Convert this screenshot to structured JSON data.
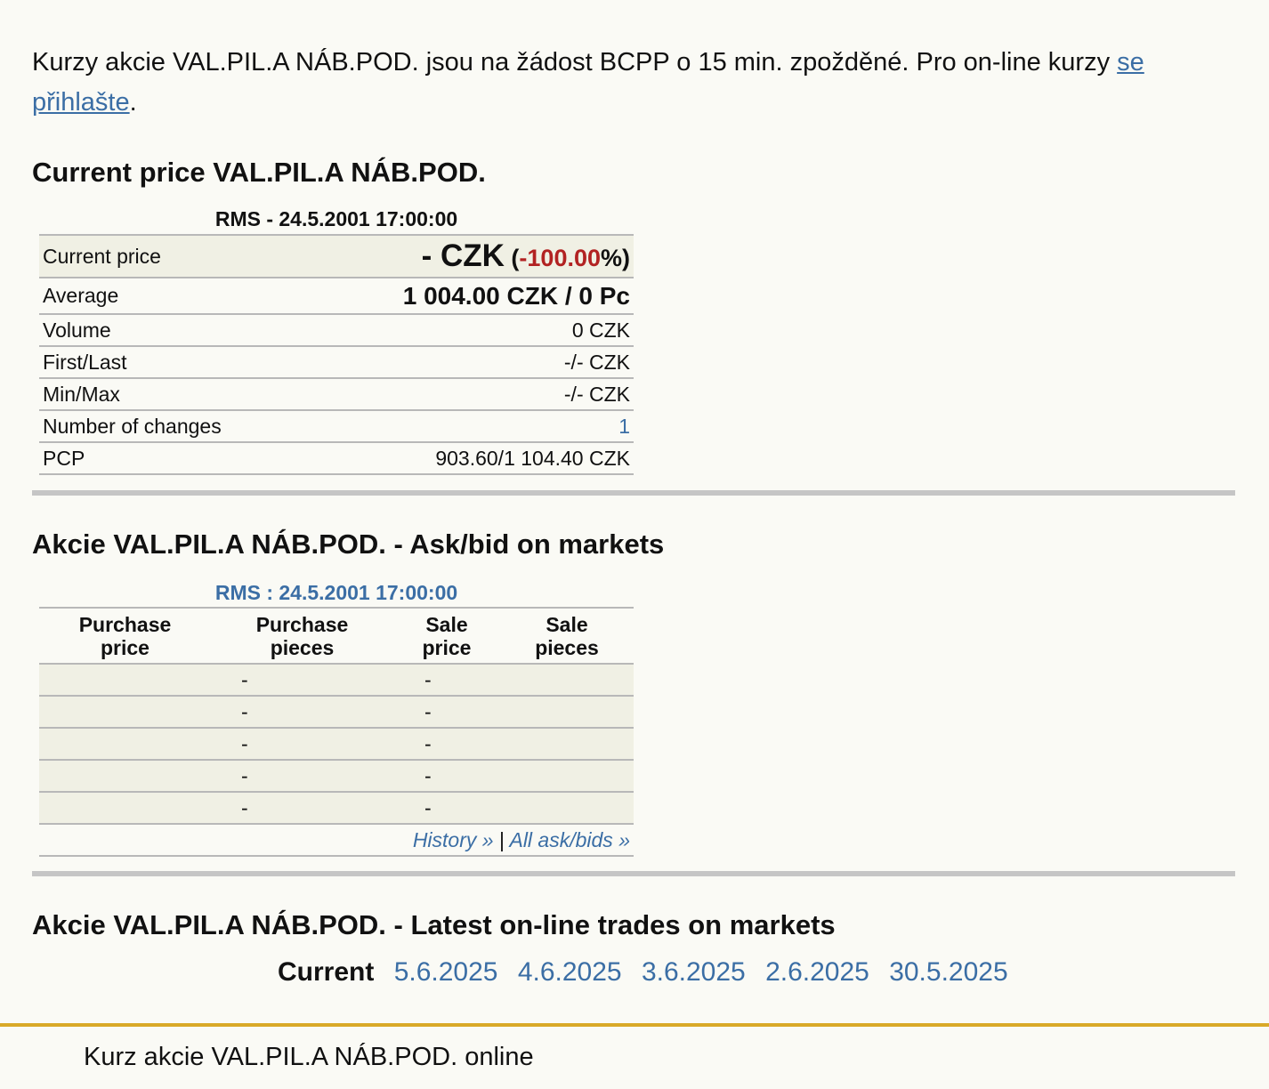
{
  "notice": {
    "text": "Kurzy akcie VAL.PIL.A NÁB.POD. jsou na žádost BCPP o 15 min. zpožděné. Pro on-line kurzy ",
    "link_text": "se přihlašte",
    "end": "."
  },
  "current": {
    "heading": "Current price VAL.PIL.A NÁB.POD.",
    "caption": "RMS - 24.5.2001 17:00:00",
    "price_label": "Current price",
    "price_value": "- CZK",
    "pct_open": " (",
    "pct_value": "-100.00",
    "pct_close": "%)",
    "average_label": "Average",
    "average_value": "1 004.00 CZK / 0 Pc",
    "rows": [
      {
        "label": "Volume",
        "value": "0 CZK"
      },
      {
        "label": "First/Last",
        "value": "-/- CZK"
      },
      {
        "label": "Min/Max",
        "value": "-/- CZK"
      },
      {
        "label": "Number of changes",
        "value": "1"
      },
      {
        "label": "PCP",
        "value": "903.60/1 104.40 CZK"
      }
    ]
  },
  "orderbook": {
    "heading": "Akcie VAL.PIL.A NÁB.POD. - Ask/bid on markets",
    "caption": "RMS : 24.5.2001 17:00:00",
    "columns": [
      "Purchase\nprice",
      "Purchase\npieces",
      "Sale\nprice",
      "Sale\npieces"
    ],
    "rows": [
      [
        "",
        "-",
        "-",
        ""
      ],
      [
        "",
        "-",
        "-",
        ""
      ],
      [
        "",
        "-",
        "-",
        ""
      ],
      [
        "",
        "-",
        "-",
        ""
      ],
      [
        "",
        "-",
        "-",
        ""
      ]
    ],
    "history_link": "History »",
    "separator": "|",
    "all_link": "All ask/bids »"
  },
  "trades": {
    "heading": "Akcie VAL.PIL.A NÁB.POD. - Latest on-line trades on markets",
    "current_label": "Current",
    "days": [
      "5.6.2025",
      "4.6.2025",
      "3.6.2025",
      "2.6.2025",
      "30.5.2025"
    ]
  },
  "footer": {
    "text": "Kurz akcie VAL.PIL.A NÁB.POD. online"
  },
  "colors": {
    "link": "#3b6ea5",
    "negative": "#b22222",
    "row_shade": "#f0f0e4",
    "footer_line": "#d9a928"
  }
}
